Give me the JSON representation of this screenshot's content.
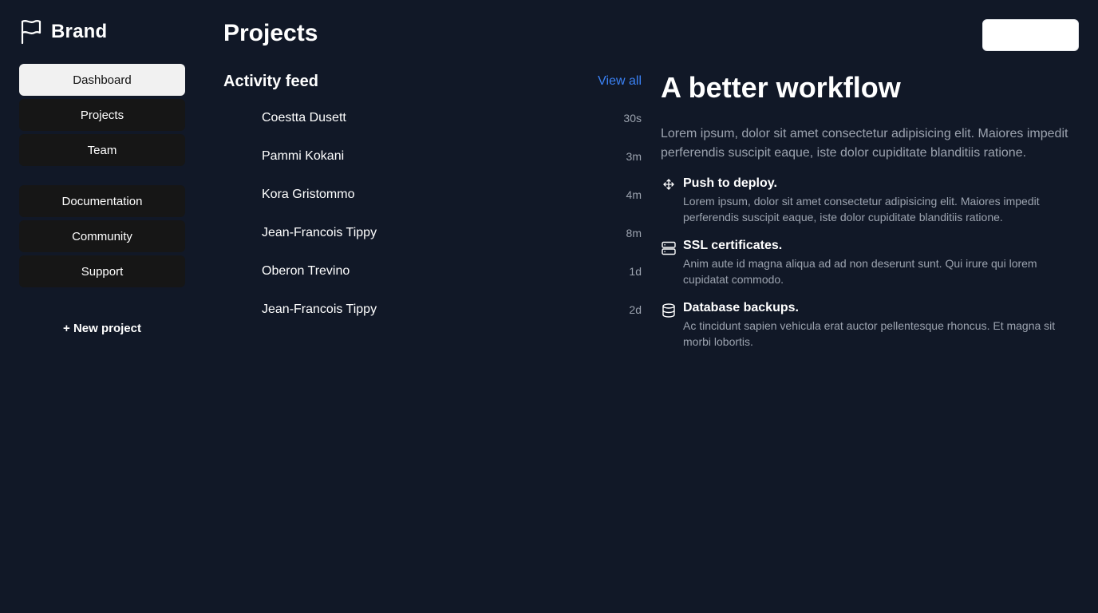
{
  "brand": {
    "name": "Brand",
    "icon": "flag-icon"
  },
  "sidebar": {
    "primary": [
      {
        "label": "Dashboard",
        "active": true
      },
      {
        "label": "Projects",
        "active": false
      },
      {
        "label": "Team",
        "active": false
      }
    ],
    "secondary": [
      {
        "label": "Documentation"
      },
      {
        "label": "Community"
      },
      {
        "label": "Support"
      }
    ],
    "new_project_label": "+ New project"
  },
  "header": {
    "title": "Projects",
    "action_button_label": ""
  },
  "feed": {
    "title": "Activity feed",
    "view_all_label": "View all",
    "items": [
      {
        "name": "Coestta Dusett",
        "time": "30s"
      },
      {
        "name": "Pammi Kokani",
        "time": "3m"
      },
      {
        "name": "Kora Gristommo",
        "time": "4m"
      },
      {
        "name": "Jean-Francois Tippy",
        "time": "8m"
      },
      {
        "name": "Oberon Trevino",
        "time": "1d"
      },
      {
        "name": "Jean-Francois Tippy",
        "time": "2d"
      }
    ]
  },
  "promo": {
    "title": "A better workflow",
    "text": "Lorem ipsum, dolor sit amet consectetur adipisicing elit. Maiores impedit perferendis suscipit eaque, iste dolor cupiditate blanditiis ratione.",
    "features": [
      {
        "icon": "move-arrows-icon",
        "title": "Push to deploy.",
        "text": "Lorem ipsum, dolor sit amet consectetur adipisicing elit. Maiores impedit perferendis suscipit eaque, iste dolor cupiditate blanditiis ratione."
      },
      {
        "icon": "server-icon",
        "title": "SSL certificates.",
        "text": "Anim aute id magna aliqua ad ad non deserunt sunt. Qui irure qui lorem cupidatat commodo."
      },
      {
        "icon": "database-icon",
        "title": "Database backups.",
        "text": "Ac tincidunt sapien vehicula erat auctor pellentesque rhoncus. Et magna sit morbi lobortis."
      }
    ]
  },
  "colors": {
    "background": "#111827",
    "nav_button": "#161616",
    "nav_active": "#f1f1f1",
    "link": "#3b82f6",
    "muted_text": "#9ca3af"
  }
}
